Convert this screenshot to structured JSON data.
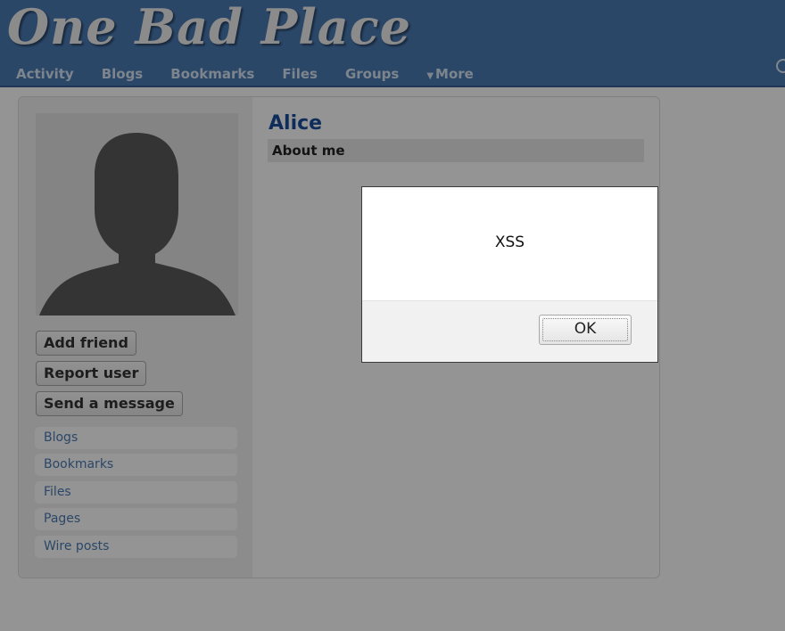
{
  "header": {
    "site_title": "One Bad Place",
    "nav": [
      "Activity",
      "Blogs",
      "Bookmarks",
      "Files",
      "Groups"
    ],
    "more_label": "More",
    "more_icon": "dropdown-triangle-icon",
    "search_icon": "search-icon"
  },
  "profile": {
    "name": "Alice",
    "about_heading": "About me",
    "avatar_icon": "default-user-silhouette"
  },
  "actions": {
    "add_friend": "Add friend",
    "report_user": "Report user",
    "send_message": "Send a message"
  },
  "sidebar_links": [
    "Blogs",
    "Bookmarks",
    "Files",
    "Pages",
    "Wire posts"
  ],
  "alert": {
    "message": "XSS",
    "ok_label": "OK"
  },
  "colors": {
    "header_bg": "#4a7ab4",
    "link": "#4a7ab4",
    "name": "#1b4f9c",
    "overlay": "rgba(0,0,0,0.42)"
  }
}
